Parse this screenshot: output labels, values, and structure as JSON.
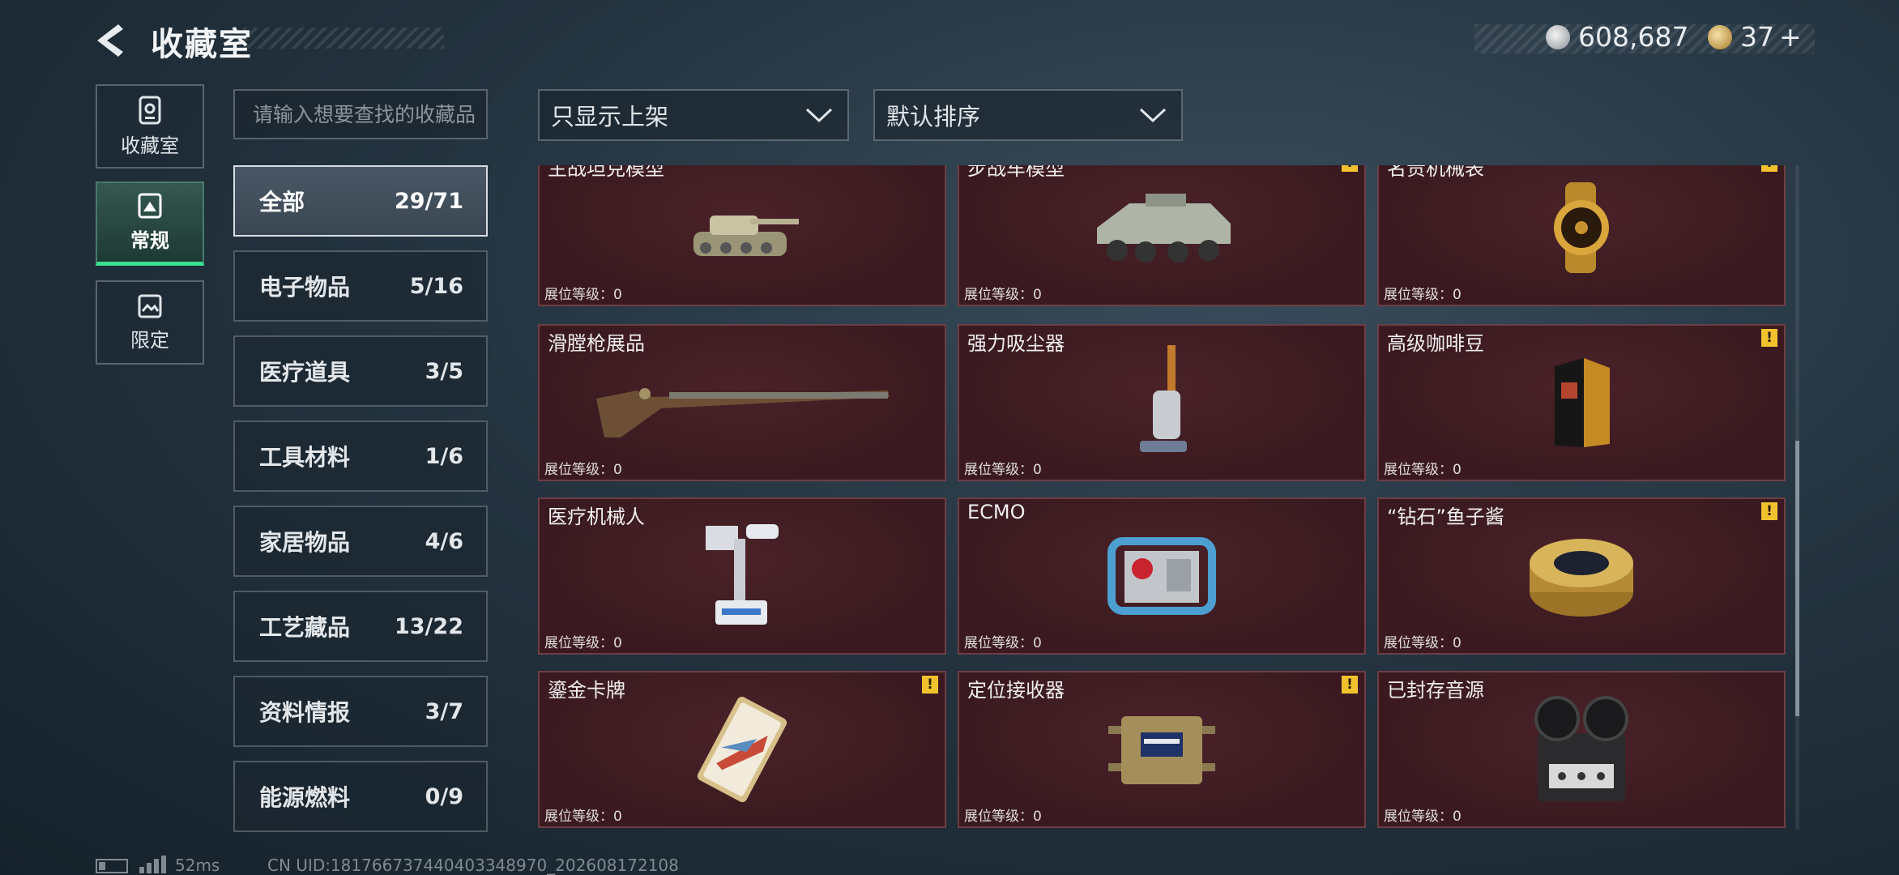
{
  "header": {
    "title": "收藏室"
  },
  "currency": {
    "silver": "608,687",
    "gold": "37",
    "gold_plus": "+"
  },
  "side_tabs": [
    {
      "label": "收藏室",
      "icon": "vault-icon"
    },
    {
      "label": "常规",
      "icon": "frame-icon"
    },
    {
      "label": "限定",
      "icon": "landscape-icon"
    }
  ],
  "search": {
    "placeholder": "请输入想要查找的收藏品"
  },
  "categories": [
    {
      "name": "全部",
      "count": "29/71"
    },
    {
      "name": "电子物品",
      "count": "5/16"
    },
    {
      "name": "医疗道具",
      "count": "3/5"
    },
    {
      "name": "工具材料",
      "count": "1/6"
    },
    {
      "name": "家居物品",
      "count": "4/6"
    },
    {
      "name": "工艺藏品",
      "count": "13/22"
    },
    {
      "name": "资料情报",
      "count": "3/7"
    },
    {
      "name": "能源燃料",
      "count": "0/9"
    }
  ],
  "filters": {
    "filter_label": "只显示上架",
    "sort_label": "默认排序"
  },
  "items": [
    {
      "name": "主战坦克模型",
      "level": "展位等级：0",
      "warn": ""
    },
    {
      "name": "步战车模型",
      "level": "展位等级：0",
      "warn": "!"
    },
    {
      "name": "名贵机械表",
      "level": "展位等级：0",
      "warn": "!"
    },
    {
      "name": "滑膛枪展品",
      "level": "展位等级：0",
      "warn": ""
    },
    {
      "name": "强力吸尘器",
      "level": "展位等级：0",
      "warn": ""
    },
    {
      "name": "高级咖啡豆",
      "level": "展位等级：0",
      "warn": "!"
    },
    {
      "name": "医疗机械人",
      "level": "展位等级：0",
      "warn": ""
    },
    {
      "name": "ECMO",
      "level": "展位等级：0",
      "warn": ""
    },
    {
      "name": "“钻石”鱼子酱",
      "level": "展位等级：0",
      "warn": "!"
    },
    {
      "name": "鎏金卡牌",
      "level": "展位等级：0",
      "warn": "!"
    },
    {
      "name": "定位接收器",
      "level": "展位等级：0",
      "warn": "!"
    },
    {
      "name": "已封存音源",
      "level": "展位等级：0",
      "warn": ""
    }
  ],
  "footer": {
    "ping": "52ms",
    "uid": "CN UID:181766737440403348970_202608172108"
  }
}
